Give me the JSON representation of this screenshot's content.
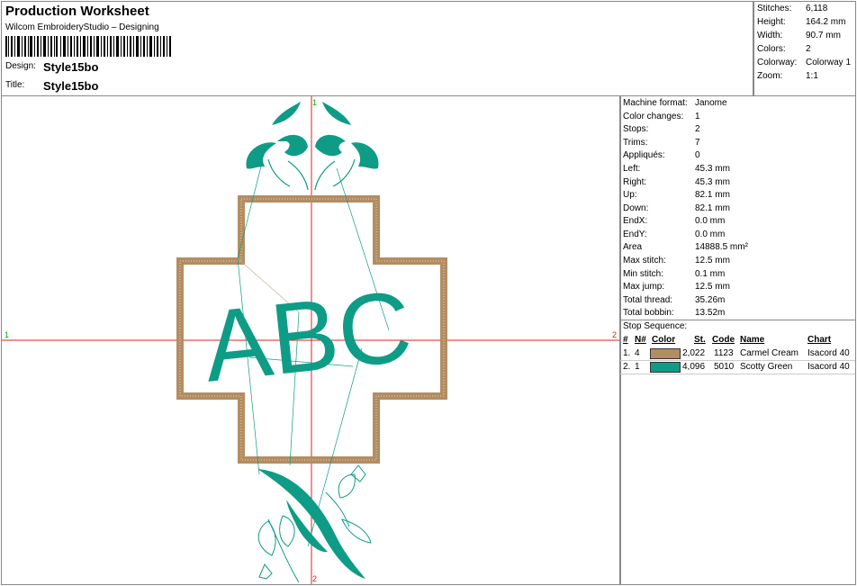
{
  "header": {
    "title": "Production Worksheet",
    "software": "Wilcom EmbroideryStudio – Designing",
    "design_label": "Design:",
    "design_value": "Style15bo",
    "title_label": "Title:",
    "title_value": "Style15bo"
  },
  "stats": [
    {
      "key": "Stitches:",
      "value": "6,118"
    },
    {
      "key": "Height:",
      "value": "164.2 mm"
    },
    {
      "key": "Width:",
      "value": "90.7 mm"
    },
    {
      "key": "Colors:",
      "value": "2"
    },
    {
      "key": "Colorway:",
      "value": "Colorway 1"
    },
    {
      "key": "Zoom:",
      "value": "1:1"
    }
  ],
  "machine_info": [
    {
      "key": "Machine format:",
      "value": "Janome"
    },
    {
      "key": "Color changes:",
      "value": "1"
    },
    {
      "key": "Stops:",
      "value": "2"
    },
    {
      "key": "Trims:",
      "value": "7"
    },
    {
      "key": "Appliqués:",
      "value": "0"
    },
    {
      "key": "Left:",
      "value": "45.3 mm"
    },
    {
      "key": "Right:",
      "value": "45.3 mm"
    },
    {
      "key": "Up:",
      "value": "82.1 mm"
    },
    {
      "key": "Down:",
      "value": "82.1 mm"
    },
    {
      "key": "EndX:",
      "value": "0.0 mm"
    },
    {
      "key": "EndY:",
      "value": "0.0 mm"
    },
    {
      "key": "Area",
      "value": "14888.5 mm²"
    },
    {
      "key": "Max stitch:",
      "value": "12.5 mm"
    },
    {
      "key": "Min stitch:",
      "value": "0.1 mm"
    },
    {
      "key": "Max jump:",
      "value": "12.5 mm"
    },
    {
      "key": "Total thread:",
      "value": "35.26m"
    },
    {
      "key": "Total bobbin:",
      "value": "13.52m"
    }
  ],
  "stop_sequence": {
    "label": "Stop Sequence:",
    "headers": {
      "num": "#",
      "n": "N#",
      "color": "Color",
      "st": "St.",
      "code": "Code",
      "name": "Name",
      "chart": "Chart"
    },
    "rows": [
      {
        "num": "1.",
        "n": "4",
        "hex": "#B38D62",
        "st": "2,022",
        "code": "1123",
        "name": "Carmel Cream",
        "chart": "Isacord 40"
      },
      {
        "num": "2.",
        "n": "1",
        "hex": "#0E9C86",
        "st": "4,096",
        "code": "5010",
        "name": "Scotty Green",
        "chart": "Isacord 40"
      }
    ]
  },
  "design": {
    "monogram": "ABC",
    "axis_labels": {
      "left": "1",
      "right": "2",
      "top": "1",
      "bottom": "2"
    },
    "colors": {
      "border": "#B38D62",
      "thread": "#0E9C86",
      "axis": "#E02020"
    }
  }
}
